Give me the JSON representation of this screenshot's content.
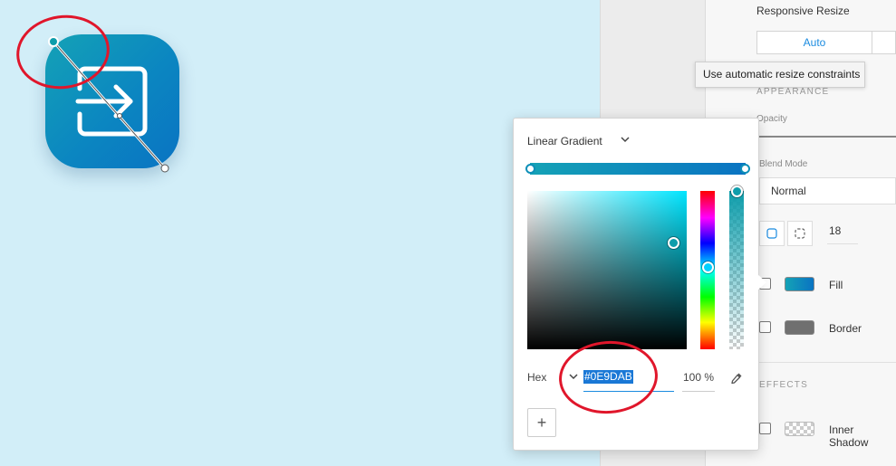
{
  "inspector": {
    "responsive_resize_title": "Responsive Resize",
    "resize_auto_label": "Auto",
    "tooltip": "Use automatic resize constraints",
    "appearance_heading": "APPEARANCE",
    "opacity_label": "Opacity",
    "blend_mode_label": "Blend Mode",
    "blend_mode_value": "Normal",
    "corner_radius_value": "18",
    "fill_label": "Fill",
    "border_label": "Border",
    "effects_heading": "EFFECTS",
    "inner_shadow_label": "Inner Shadow"
  },
  "picker": {
    "gradient_type": "Linear Gradient",
    "hex_label": "Hex",
    "hex_value": "#0E9DAB",
    "opacity_value": "100 %",
    "add_label": "+"
  },
  "colors": {
    "canvas_bg": "#d2eef8",
    "accent": "#1a8be0",
    "selected_color": "#0E9DAB",
    "annotation_red": "#e0162b"
  },
  "icons": {
    "app_icon_glyph": "sign-in-arrow-icon",
    "gradient_type_chevron": "chevron-down-icon",
    "hex_mode_chevron": "chevron-down-icon",
    "eyedropper": "eyedropper-icon"
  }
}
